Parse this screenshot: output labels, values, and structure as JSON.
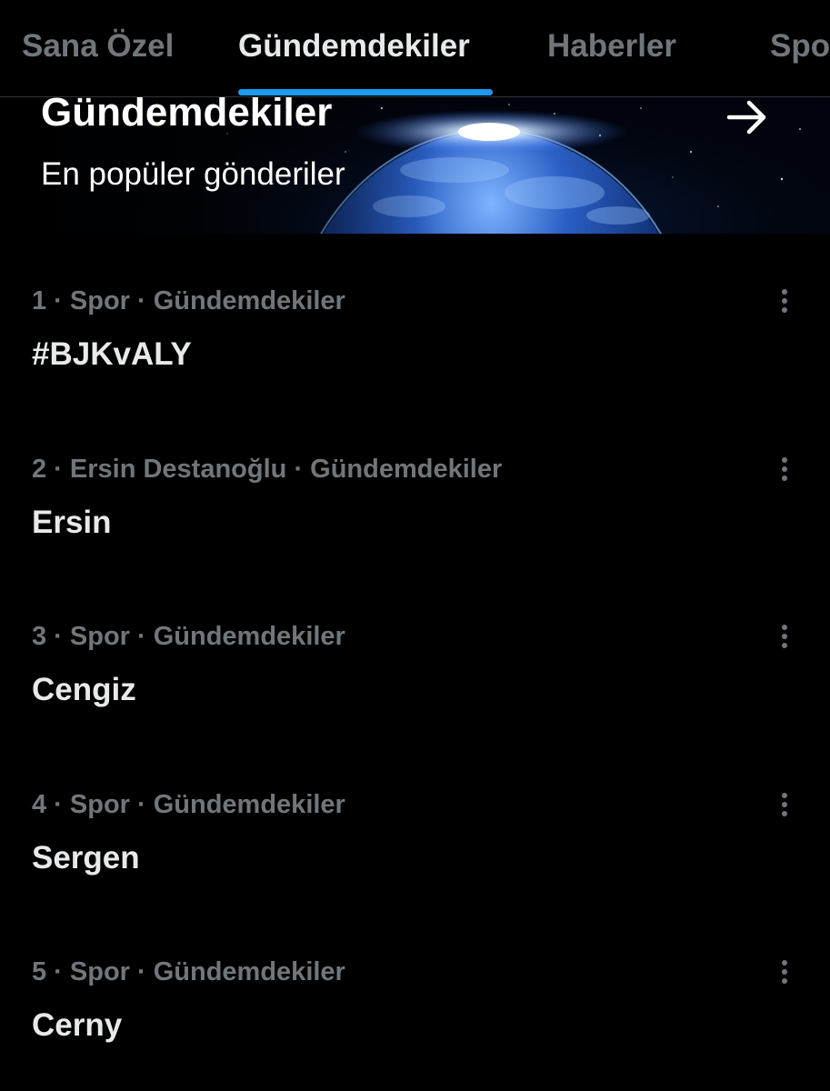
{
  "tabs": [
    {
      "label": "Sana Özel",
      "active": false
    },
    {
      "label": "Gündemdekiler",
      "active": true
    },
    {
      "label": "Haberler",
      "active": false
    },
    {
      "label": "Spor",
      "active": false
    }
  ],
  "banner": {
    "title": "Gündemdekiler",
    "subtitle": "En popüler gönderiler",
    "arrow_icon": "arrow-right-icon"
  },
  "trends": [
    {
      "meta": "1 · Spor · Gündemdekiler",
      "name": "#BJKvALY"
    },
    {
      "meta": "2 · Ersin Destanoğlu · Gündemdekiler",
      "name": "Ersin"
    },
    {
      "meta": "3 · Spor · Gündemdekiler",
      "name": "Cengiz"
    },
    {
      "meta": "4 · Spor · Gündemdekiler",
      "name": "Sergen"
    },
    {
      "meta": "5 · Spor · Gündemdekiler",
      "name": "Cerny"
    }
  ],
  "icons": {
    "more": "more-vertical-icon"
  },
  "colors": {
    "background": "#000000",
    "accent": "#1d9bf0",
    "text_primary": "#e7e9ea",
    "text_secondary": "#71767b"
  }
}
